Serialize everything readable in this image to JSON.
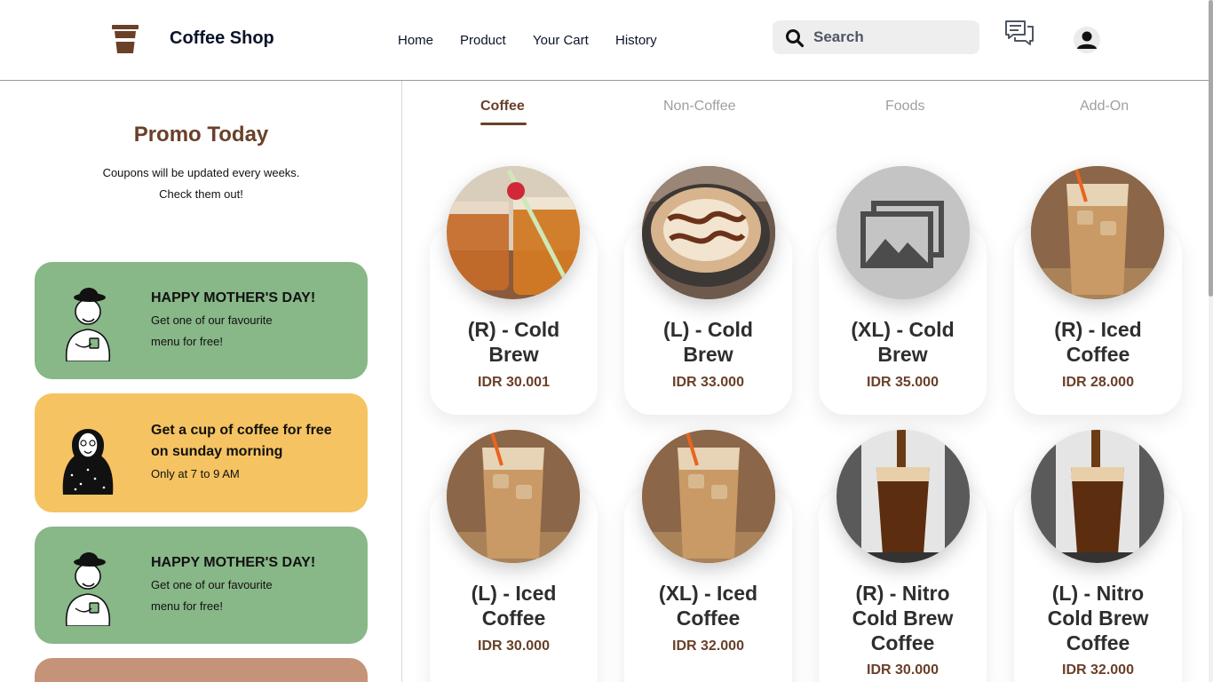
{
  "header": {
    "brand": "Coffee Shop",
    "nav": [
      "Home",
      "Product",
      "Your Cart",
      "History"
    ],
    "search_placeholder": "Search"
  },
  "sidebar": {
    "title": "Promo Today",
    "subtitle_line1": "Coupons will be updated every weeks.",
    "subtitle_line2": "Check them out!",
    "coupons": [
      {
        "title": "HAPPY MOTHER'S DAY!",
        "desc1": "Get one of our favourite",
        "desc2": "menu for free!",
        "color": "#88b788"
      },
      {
        "title1": "Get a cup of coffee for free",
        "title2": "on sunday morning",
        "desc1": "Only at 7 to 9 AM",
        "color": "#f5c361"
      },
      {
        "title": "HAPPY MOTHER'S DAY!",
        "desc1": "Get one of our favourite",
        "desc2": "menu for free!",
        "color": "#88b788"
      },
      {
        "color": "#c59378"
      }
    ]
  },
  "tabs": [
    "Coffee",
    "Non-Coffee",
    "Foods",
    "Add-On"
  ],
  "active_tab": "Coffee",
  "products": [
    {
      "line1": "(R) - Cold",
      "line2": "Brew",
      "price": "IDR 30.001",
      "image": "iced-tea-jars"
    },
    {
      "line1": "(L) - Cold",
      "line2": "Brew",
      "price": "IDR 33.000",
      "image": "latte-art"
    },
    {
      "line1": "(XL) - Cold",
      "line2": "Brew",
      "price": "IDR 35.000",
      "image": "placeholder-gallery"
    },
    {
      "line1": "(R) - Iced",
      "line2": "Coffee",
      "price": "IDR 28.000",
      "image": "iced-coffee"
    },
    {
      "line1": "(L) - Iced",
      "line2": "Coffee",
      "price": "IDR 30.000",
      "image": "iced-coffee"
    },
    {
      "line1": "(XL) - Iced",
      "line2": "Coffee",
      "price": "IDR 32.000",
      "image": "iced-coffee"
    },
    {
      "line1": "(R) - Nitro",
      "line2": "Cold Brew",
      "line3": "Coffee",
      "price": "IDR 30.000",
      "image": "nitro-pour"
    },
    {
      "line1": "(L) - Nitro",
      "line2": "Cold Brew",
      "line3": "Coffee",
      "price": "IDR 32.000",
      "image": "nitro-pour"
    }
  ],
  "colors": {
    "brown": "#6a4029",
    "green": "#88b788",
    "yellow": "#f5c361",
    "tan": "#c59378",
    "search_bg": "#efeeee"
  }
}
